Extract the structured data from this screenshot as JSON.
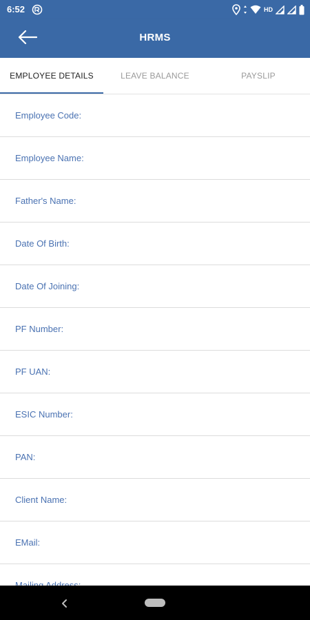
{
  "status_bar": {
    "time": "6:52",
    "hd_label": "HD",
    "icons": [
      "notification-icon",
      "location-icon",
      "data-arrows-icon",
      "wifi-icon",
      "signal-icon",
      "signal-icon",
      "battery-icon"
    ]
  },
  "app_bar": {
    "title": "HRMS",
    "back_icon": "arrow-left-icon"
  },
  "tabs": [
    {
      "label": "EMPLOYEE DETAILS",
      "active": true
    },
    {
      "label": "LEAVE BALANCE",
      "active": false
    },
    {
      "label": "PAYSLIP",
      "active": false
    }
  ],
  "fields": [
    {
      "label": "Employee Code:"
    },
    {
      "label": "Employee Name:"
    },
    {
      "label": "Father's Name:"
    },
    {
      "label": "Date Of Birth:"
    },
    {
      "label": "Date Of Joining:"
    },
    {
      "label": "PF Number:"
    },
    {
      "label": "PF UAN:"
    },
    {
      "label": "ESIC Number:"
    },
    {
      "label": "PAN:"
    },
    {
      "label": "Client Name:"
    },
    {
      "label": "EMail:"
    },
    {
      "label": "Mailing Address:"
    }
  ],
  "nav_bar": {
    "back_icon": "nav-back-icon",
    "home_icon": "nav-home-pill"
  },
  "colors": {
    "primary": "#3a69a6",
    "label": "#4a72b2",
    "divider": "#dcdcdc"
  }
}
